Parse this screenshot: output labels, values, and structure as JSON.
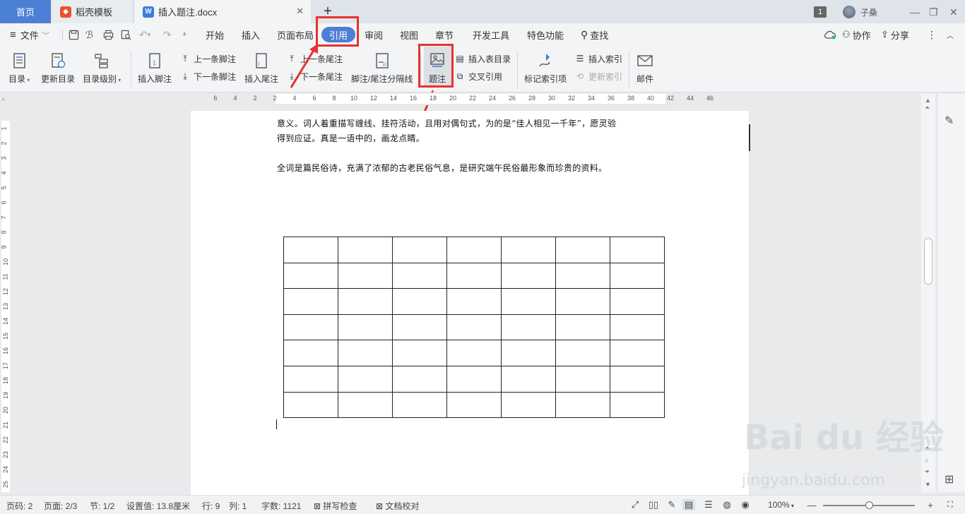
{
  "tabs": {
    "home": "首页",
    "template": "稻壳模板",
    "doc": "插入题注.docx",
    "plus": "+"
  },
  "titlebar": {
    "badge": "1",
    "user": "子桑"
  },
  "menu": {
    "file": "文件",
    "items": [
      "开始",
      "插入",
      "页面布局",
      "引用",
      "审阅",
      "视图",
      "章节",
      "开发工具",
      "特色功能",
      "查找"
    ],
    "collab": "协作",
    "share": "分享"
  },
  "ribbon": {
    "toc": "目录",
    "update_toc": "更新目录",
    "toc_level": "目录级别",
    "insert_footnote": "插入脚注",
    "prev_footnote": "上一条脚注",
    "next_footnote": "下一条脚注",
    "insert_endnote": "插入尾注",
    "prev_endnote": "上一条尾注",
    "next_endnote": "下一条尾注",
    "separator": "脚注/尾注分隔线",
    "caption": "题注",
    "insert_table_of_figures": "插入表目录",
    "cross_reference": "交叉引用",
    "mark_index": "标记索引项",
    "insert_index": "插入索引",
    "update_index": "更新索引",
    "mail": "邮件"
  },
  "ruler": {
    "h": [
      "6",
      "4",
      "2",
      "2",
      "4",
      "6",
      "8",
      "10",
      "12",
      "14",
      "16",
      "18",
      "20",
      "22",
      "24",
      "26",
      "28",
      "30",
      "32",
      "34",
      "36",
      "38",
      "40",
      "42",
      "44",
      "46"
    ],
    "v": [
      "1",
      "2",
      "3",
      "4",
      "5",
      "6",
      "7",
      "8",
      "9",
      "10",
      "11",
      "12",
      "13",
      "14",
      "15",
      "16",
      "17",
      "18",
      "19",
      "20",
      "21",
      "22",
      "23",
      "24",
      "25"
    ]
  },
  "document": {
    "line1": "意义。词人着重描写缠线、挂符活动，且用对偶句式，为的是“佳人相见一千年”，愿灵验",
    "line2": "得到应证。真是一语中的，画龙点睛。",
    "line3": "全词是篇民俗诗，充满了浓郁的古老民俗气息，是研究端午民俗最形象而珍贵的资料。",
    "table_rows": 7,
    "table_cols": 7
  },
  "status": {
    "page_code": "页码: 2",
    "page": "页面: 2/3",
    "section": "节: 1/2",
    "setting": "设置值: 13.8厘米",
    "row": "行: 9",
    "col": "列: 1",
    "words": "字数: 1121",
    "spell": "拼写检查",
    "proof": "文档校对",
    "zoom": "100%"
  },
  "watermark": {
    "brand": "Bai du 经验",
    "url": "jingyan.baidu.com"
  },
  "colors": {
    "accent": "#4c7fd6",
    "highlight": "#e8322c"
  }
}
